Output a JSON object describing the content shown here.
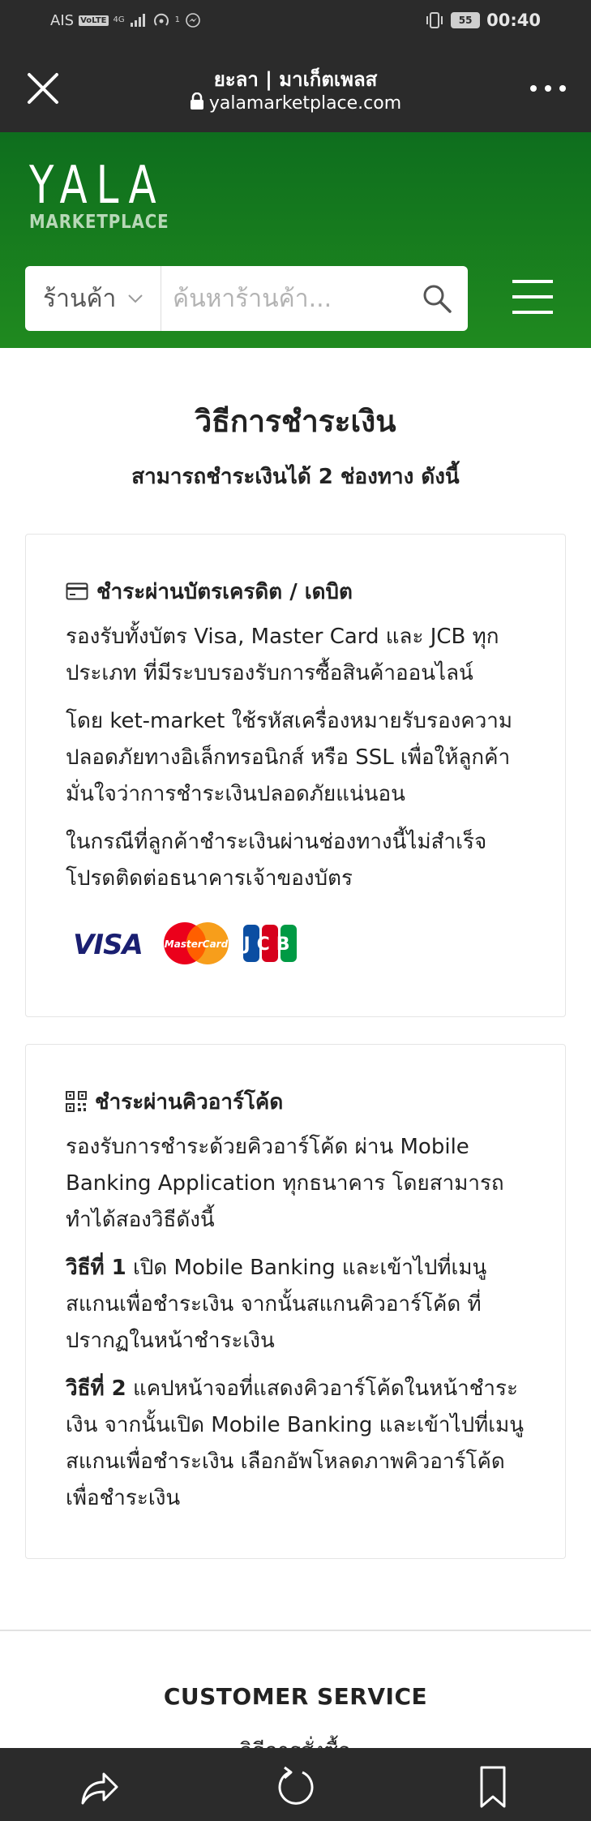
{
  "status_bar": {
    "carrier": "AIS",
    "volte": "VoLTE",
    "network": "4G",
    "notification_count": "1",
    "battery": "55",
    "time": "00:40"
  },
  "browser": {
    "title": "ยะลา | มาเก็ตเพลส",
    "url": "yalamarketplace.com"
  },
  "header": {
    "logo_main": "YALA",
    "logo_sub": "MARKETPLACE",
    "search_category": "ร้านค้า",
    "search_placeholder": "ค้นหาร้านค้า..."
  },
  "main": {
    "title": "วิธีการชำระเงิน",
    "subtitle": "สามารถชำระเงินได้ 2 ช่องทาง ดังนี้"
  },
  "credit_card": {
    "heading": "ชำระผ่านบัตรเครดิต / เดบิต",
    "para1": "รองรับทั้งบัตร Visa, Master Card และ JCB ทุกประเภท ที่มีระบบรองรับการซื้อสินค้าออนไลน์",
    "para2": "โดย ket-market ใช้รหัสเครื่องหมายรับรองความปลอดภัยทางอิเล็กทรอนิกส์ หรือ SSL เพื่อให้ลูกค้ามั่นใจว่าการชำระเงินปลอดภัยแน่นอน",
    "para3": "ในกรณีที่ลูกค้าชำระเงินผ่านช่องทางนี้ไม่สำเร็จ โปรดติดต่อธนาคารเจ้าของบัตร",
    "logos": {
      "visa": "VISA",
      "mastercard": "MasterCard",
      "jcb": "JCB"
    },
    "colors": {
      "visa": "#1a1f71",
      "mastercard_red": "#eb001b",
      "mastercard_orange": "#f79e1b",
      "jcb_blue": "#0b4ea2",
      "jcb_red": "#d6001c",
      "jcb_green": "#009a44"
    }
  },
  "qr_code": {
    "heading": "ชำระผ่านคิวอาร์โค้ด",
    "para1": "รองรับการชำระด้วยคิวอาร์โค้ด ผ่าน Mobile Banking Application ทุกธนาคาร โดยสามารถทำได้สองวิธีดังนี้",
    "method1_label": "วิธีที่ 1",
    "method1_text": " เปิด Mobile Banking และเข้าไปที่เมนูสแกนเพื่อชำระเงิน จากนั้นสแกนคิวอาร์โค้ด ที่ปรากฏในหน้าชำระเงิน",
    "method2_label": "วิธีที่ 2",
    "method2_text": " แคปหน้าจอที่แสดงคิวอาร์โค้ดในหน้าชำระเงิน จากนั้นเปิด Mobile Banking และเข้าไปที่เมนูสแกนเพื่อชำระเงิน เลือกอัพโหลดภาพคิวอาร์โค้ดเพื่อชำระเงิน"
  },
  "footer": {
    "title": "CUSTOMER SERVICE",
    "link1": "วิธีการสั่งซื้อ"
  },
  "icons": {
    "close": "close-icon",
    "lock": "lock-icon",
    "more": "more-icon",
    "chevron": "chevron-down-icon",
    "search": "search-icon",
    "menu": "hamburger-menu-icon",
    "card": "credit-card-icon",
    "qr": "qr-code-icon",
    "share": "share-icon",
    "reload": "reload-icon",
    "bookmark": "bookmark-icon"
  },
  "colors": {
    "header_green_top": "#0e6e1e",
    "header_green_bottom": "#208a1f",
    "dark_bar": "#2b2b2b"
  }
}
